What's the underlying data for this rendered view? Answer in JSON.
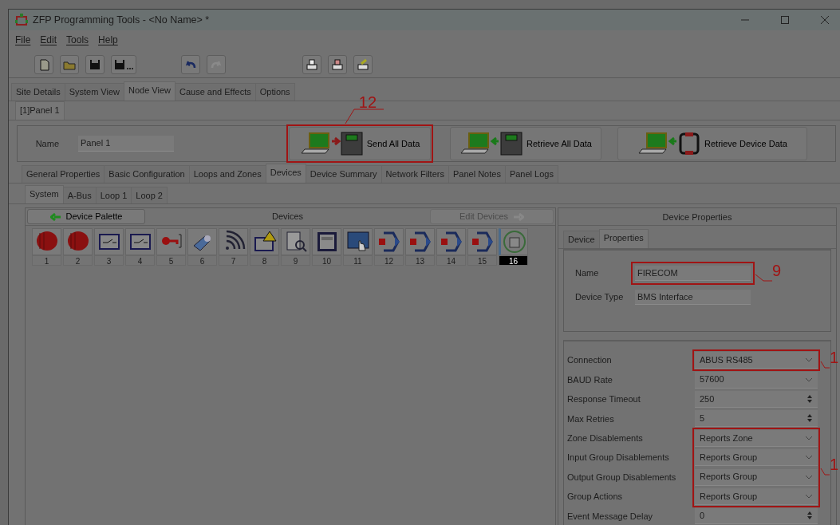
{
  "window": {
    "title": "ZFP Programming Tools - <No Name> *"
  },
  "menu": [
    "File",
    "Edit",
    "Tools",
    "Help"
  ],
  "main_tabs": [
    {
      "label": "Site Details",
      "selected": false
    },
    {
      "label": "System View",
      "selected": false
    },
    {
      "label": "Node View",
      "selected": true
    },
    {
      "label": "Cause and Effects",
      "selected": false
    },
    {
      "label": "Options",
      "selected": false
    }
  ],
  "node_tabs": [
    {
      "label": "[1]Panel 1",
      "selected": true
    }
  ],
  "panel": {
    "name_label": "Name",
    "name_value": "Panel 1",
    "actions": [
      {
        "label": "Send All Data",
        "kind": "send"
      },
      {
        "label": "Retrieve All Data",
        "kind": "retrieve"
      },
      {
        "label": "Retrieve Device Data",
        "kind": "device"
      }
    ]
  },
  "panel_tabs": [
    {
      "label": "General Properties",
      "selected": false
    },
    {
      "label": "Basic Configuration",
      "selected": false
    },
    {
      "label": "Loops and Zones",
      "selected": false
    },
    {
      "label": "Devices",
      "selected": true
    },
    {
      "label": "Device Summary",
      "selected": false
    },
    {
      "label": "Network Filters",
      "selected": false
    },
    {
      "label": "Panel Notes",
      "selected": false
    },
    {
      "label": "Panel Logs",
      "selected": false
    }
  ],
  "bus_tabs": [
    {
      "label": "System",
      "selected": true
    },
    {
      "label": "A-Bus",
      "selected": false
    },
    {
      "label": "Loop 1",
      "selected": false
    },
    {
      "label": "Loop 2",
      "selected": false
    }
  ],
  "devices": {
    "palette_button": "Device Palette",
    "title": "Devices",
    "edit_button": {
      "label": "Edit Devices",
      "disabled": true
    },
    "items": [
      {
        "number": "1",
        "kind": "sounder",
        "selected": false
      },
      {
        "number": "2",
        "kind": "sounder",
        "selected": false
      },
      {
        "number": "3",
        "kind": "switch",
        "selected": false
      },
      {
        "number": "4",
        "kind": "switch",
        "selected": false
      },
      {
        "number": "5",
        "kind": "key",
        "selected": false
      },
      {
        "number": "6",
        "kind": "beam",
        "selected": false
      },
      {
        "number": "7",
        "kind": "wireless",
        "selected": false
      },
      {
        "number": "8",
        "kind": "fault",
        "selected": false
      },
      {
        "number": "9",
        "kind": "report",
        "selected": false
      },
      {
        "number": "10",
        "kind": "panel",
        "selected": false
      },
      {
        "number": "11",
        "kind": "touch",
        "selected": false
      },
      {
        "number": "12",
        "kind": "interface",
        "selected": false
      },
      {
        "number": "13",
        "kind": "interface",
        "selected": false
      },
      {
        "number": "14",
        "kind": "interface",
        "selected": false
      },
      {
        "number": "15",
        "kind": "interface",
        "selected": false
      },
      {
        "number": "16",
        "kind": "bms",
        "selected": true
      }
    ]
  },
  "device_properties": {
    "title": "Device Properties",
    "tabs": [
      {
        "label": "Device",
        "selected": false
      },
      {
        "label": "Properties",
        "selected": true
      }
    ],
    "name_label": "Name",
    "name_value": "FIRECOM",
    "type_label": "Device Type",
    "type_value": "BMS Interface",
    "settings": [
      {
        "label": "Connection",
        "value": "ABUS RS485",
        "kind": "select"
      },
      {
        "label": "BAUD Rate",
        "value": "57600",
        "kind": "select"
      },
      {
        "label": "Response Timeout",
        "value": "250",
        "kind": "spin"
      },
      {
        "label": "Max Retries",
        "value": "5",
        "kind": "spin"
      },
      {
        "label": "Zone Disablements",
        "value": "Reports Zone",
        "kind": "select"
      },
      {
        "label": "Input Group Disablements",
        "value": "Reports Group",
        "kind": "select"
      },
      {
        "label": "Output Group Disablements",
        "value": "Reports Group",
        "kind": "select"
      },
      {
        "label": "Group Actions",
        "value": "Reports Group",
        "kind": "select"
      },
      {
        "label": "Event Message Delay",
        "value": "0",
        "kind": "spin"
      }
    ]
  },
  "annotations": [
    {
      "label": "12"
    },
    {
      "label": "9"
    },
    {
      "label": "1"
    },
    {
      "label": "1"
    }
  ]
}
